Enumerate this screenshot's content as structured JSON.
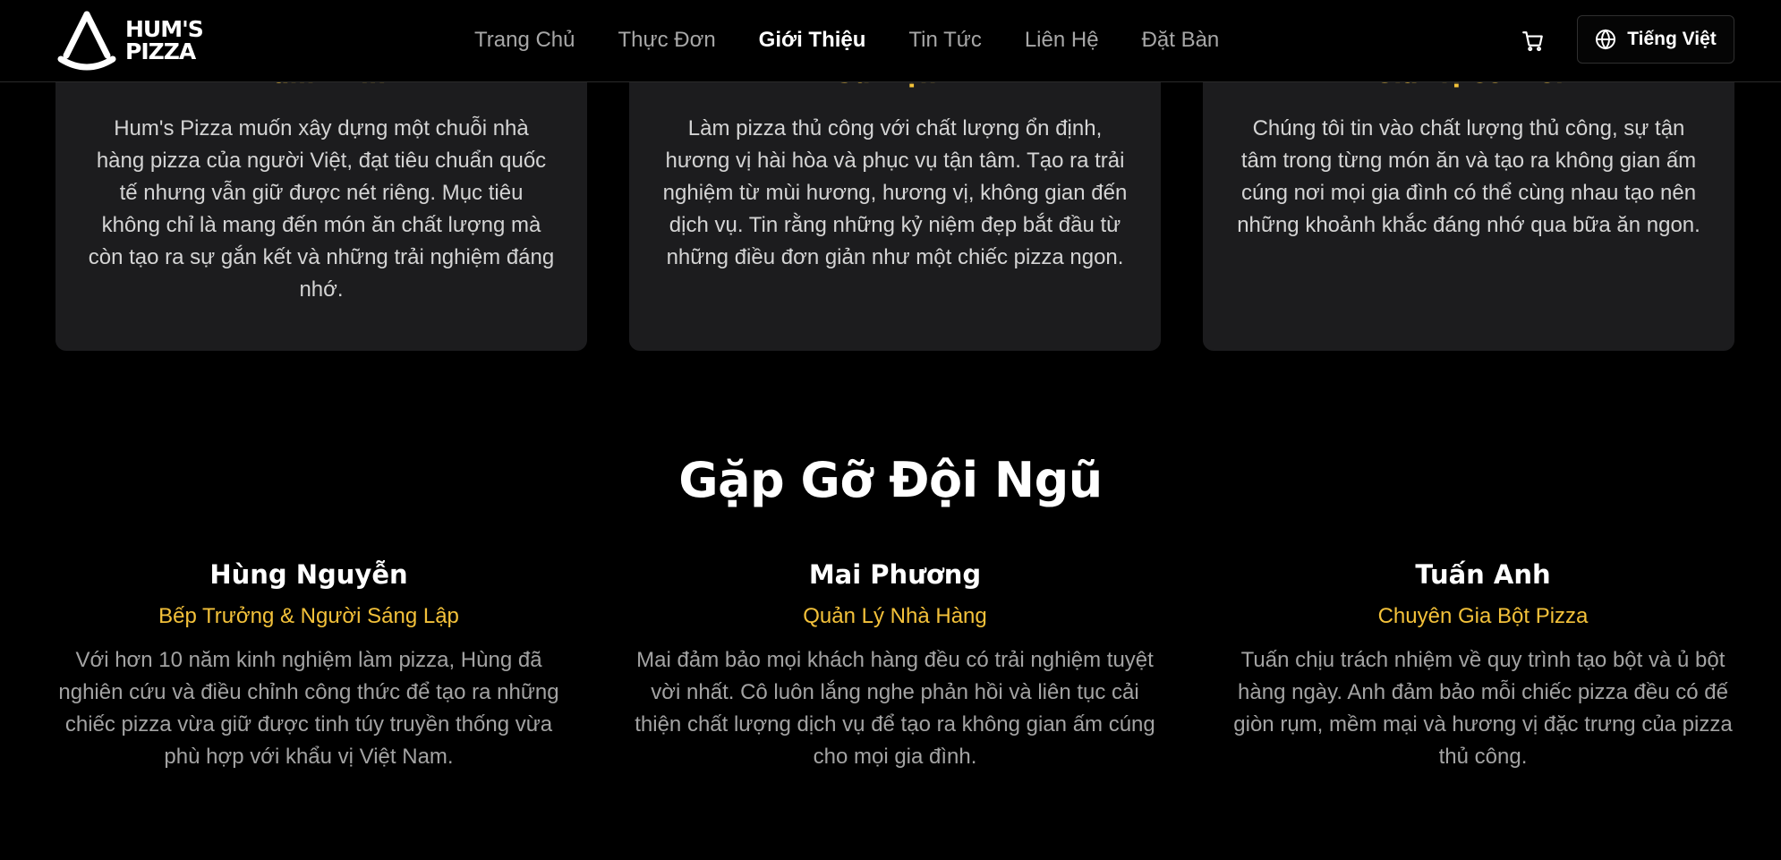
{
  "header": {
    "logo_line1": "HUM'S",
    "logo_line2": "PIZZA",
    "nav": [
      {
        "label": "Trang Chủ",
        "active": false
      },
      {
        "label": "Thực Đơn",
        "active": false
      },
      {
        "label": "Giới Thiệu",
        "active": true
      },
      {
        "label": "Tin Tức",
        "active": false
      },
      {
        "label": "Liên Hệ",
        "active": false
      },
      {
        "label": "Đặt Bàn",
        "active": false
      }
    ],
    "cart_icon": "shopping-cart-icon",
    "language": {
      "icon": "globe-icon",
      "label": "Tiếng Việt"
    }
  },
  "values": [
    {
      "title": "Tầm Nhìn",
      "text": "Hum's Pizza muốn xây dựng một chuỗi nhà hàng pizza của người Việt, đạt tiêu chuẩn quốc tế nhưng vẫn giữ được nét riêng. Mục tiêu không chỉ là mang đến món ăn chất lượng mà còn tạo ra sự gắn kết và những trải nghiệm đáng nhớ."
    },
    {
      "title": "Sứ Mệnh",
      "text": "Làm pizza thủ công với chất lượng ổn định, hương vị hài hòa và phục vụ tận tâm. Tạo ra trải nghiệm từ mùi hương, hương vị, không gian đến dịch vụ. Tin rằng những kỷ niệm đẹp bắt đầu từ những điều đơn giản như một chiếc pizza ngon."
    },
    {
      "title": "Giá Trị Cốt Lõi",
      "text": "Chúng tôi tin vào chất lượng thủ công, sự tận tâm trong từng món ăn và tạo ra không gian ấm cúng nơi mọi gia đình có thể cùng nhau tạo nên những khoảnh khắc đáng nhớ qua bữa ăn ngon."
    }
  ],
  "team": {
    "title": "Gặp Gỡ Đội Ngũ",
    "members": [
      {
        "name": "Hùng Nguyễn",
        "role": "Bếp Trưởng & Người Sáng Lập",
        "bio": "Với hơn 10 năm kinh nghiệm làm pizza, Hùng đã nghiên cứu và điều chỉnh công thức để tạo ra những chiếc pizza vừa giữ được tinh túy truyền thống vừa phù hợp với khẩu vị Việt Nam."
      },
      {
        "name": "Mai Phương",
        "role": "Quản Lý Nhà Hàng",
        "bio": "Mai đảm bảo mọi khách hàng đều có trải nghiệm tuyệt vời nhất. Cô luôn lắng nghe phản hồi và liên tục cải thiện chất lượng dịch vụ để tạo ra không gian ấm cúng cho mọi gia đình."
      },
      {
        "name": "Tuấn Anh",
        "role": "Chuyên Gia Bột Pizza",
        "bio": "Tuấn chịu trách nhiệm về quy trình tạo bột và ủ bột hàng ngày. Anh đảm bảo mỗi chiếc pizza đều có đế giòn rụm, mềm mại và hương vị đặc trưng của pizza thủ công."
      }
    ]
  },
  "colors": {
    "background": "#000000",
    "card": "#1c1c1e",
    "accent": "#f3c13a",
    "muted_text": "#a3a3a3"
  }
}
